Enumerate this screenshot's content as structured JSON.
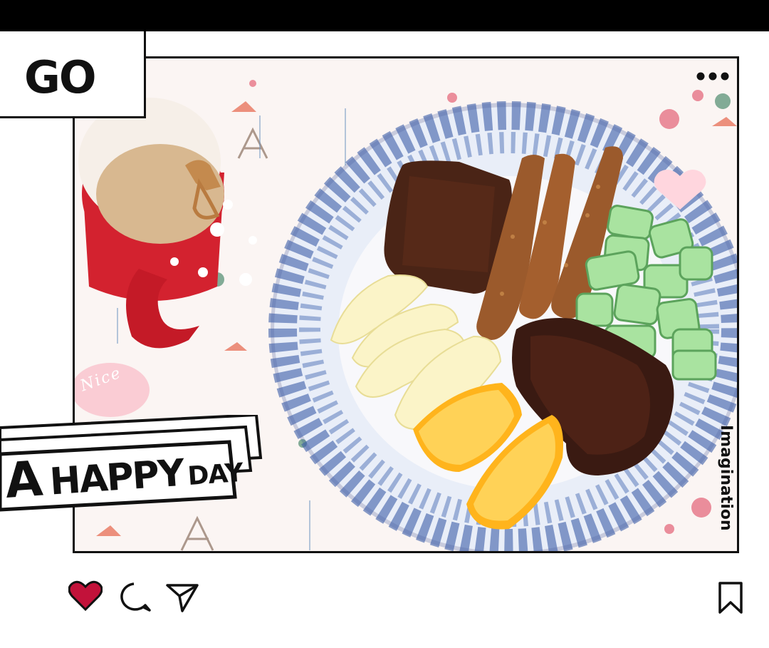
{
  "header": {
    "label": "GO"
  },
  "banner": {
    "word_a": "A",
    "word_happy": "HAPPY",
    "word_day": "DAY"
  },
  "stickers": {
    "nice": "Nice",
    "side_text": "Imagination"
  },
  "icons": {
    "more": "more-dots-icon",
    "like": "heart-icon",
    "comment": "comment-bubble-icon",
    "share": "paper-plane-icon",
    "save": "bookmark-icon"
  },
  "colors": {
    "like": "#c2123a",
    "frame": "#111111"
  }
}
